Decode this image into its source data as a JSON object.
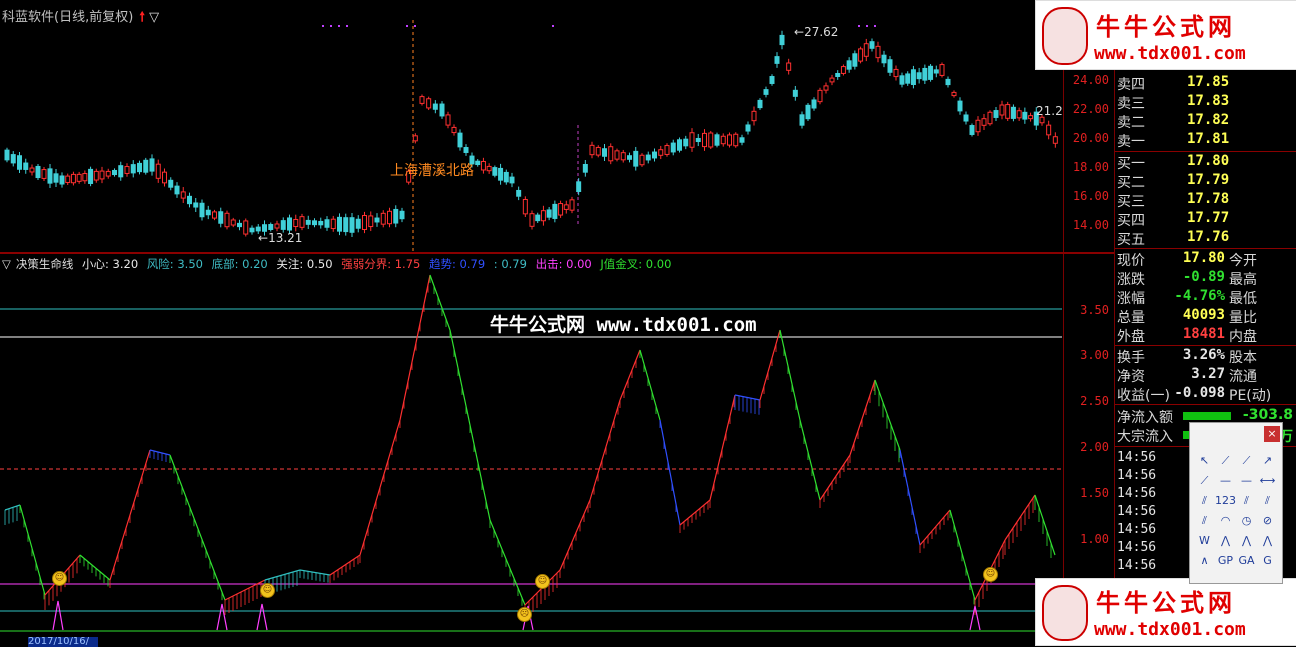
{
  "window": {
    "title": "科蓝软件(日线,前复权)"
  },
  "price_axis": {
    "ticks": [
      "24.00",
      "22.00",
      "20.00",
      "18.00",
      "16.00",
      "14.00"
    ]
  },
  "price_annotations": {
    "high": "27.62",
    "low": "13.21",
    "right_edge": "21.2",
    "road_label": "上海漕溪北路"
  },
  "indicator": {
    "name": "决策生命线",
    "params": [
      {
        "label": "小心: 3.20",
        "color": "#e8e8e8"
      },
      {
        "label": "风险: 3.50",
        "color": "#3fbcc4"
      },
      {
        "label": "底部: 0.20",
        "color": "#3fbcc4"
      },
      {
        "label": "关注: 0.50",
        "color": "#e8e8e8"
      },
      {
        "label": "强弱分界: 1.75",
        "color": "#ff4040"
      },
      {
        "label": "趋势: 0.79",
        "color": "#3050ff"
      },
      {
        "label": ": 0.79",
        "color": "#3fbcc4"
      },
      {
        "label": "出击: 0.00",
        "color": "#ff40ff"
      },
      {
        "label": "J值金叉: 0.00",
        "color": "#30e030"
      }
    ],
    "axis_ticks": [
      "3.50",
      "3.00",
      "2.50",
      "2.00",
      "1.50",
      "1.00"
    ]
  },
  "center_watermark": "牛牛公式网 www.tdx001.com",
  "watermark": {
    "title": "牛牛公式网",
    "url": "www.tdx001.com"
  },
  "orderbook": {
    "asks": [
      {
        "label": "卖四",
        "price": "17.85"
      },
      {
        "label": "卖三",
        "price": "17.83"
      },
      {
        "label": "卖二",
        "price": "17.82"
      },
      {
        "label": "卖一",
        "price": "17.81"
      }
    ],
    "bids": [
      {
        "label": "买一",
        "price": "17.80"
      },
      {
        "label": "买二",
        "price": "17.79"
      },
      {
        "label": "买三",
        "price": "17.78"
      },
      {
        "label": "买四",
        "price": "17.77"
      },
      {
        "label": "买五",
        "price": "17.76"
      }
    ]
  },
  "quote": [
    {
      "label": "现价",
      "value": "17.80",
      "label2": "今开",
      "color": "#ffff55"
    },
    {
      "label": "涨跌",
      "value": "-0.89",
      "label2": "最高",
      "color": "#30e030"
    },
    {
      "label": "涨幅",
      "value": "-4.76%",
      "label2": "最低",
      "color": "#30e030"
    },
    {
      "label": "总量",
      "value": "40093",
      "label2": "量比",
      "color": "#ffff55"
    },
    {
      "label": "外盘",
      "value": "18481",
      "label2": "内盘",
      "color": "#ff4040"
    },
    {
      "label": "换手",
      "value": "3.26%",
      "label2": "股本",
      "color": "#e6e6e6"
    },
    {
      "label": "净资",
      "value": "3.27",
      "label2": "流通",
      "color": "#e6e6e6"
    },
    {
      "label": "收益(一)",
      "value": "-0.098",
      "label2": "PE(动)",
      "color": "#e6e6e6"
    }
  ],
  "flows": [
    {
      "label": "净流入额",
      "value": "-303.8"
    },
    {
      "label": "大宗流入",
      "value": "1万"
    }
  ],
  "ticks": [
    "14:56",
    "14:56",
    "14:56",
    "14:56",
    "14:56",
    "14:56",
    "14:56"
  ],
  "date_label": "2017/10/16/"
}
